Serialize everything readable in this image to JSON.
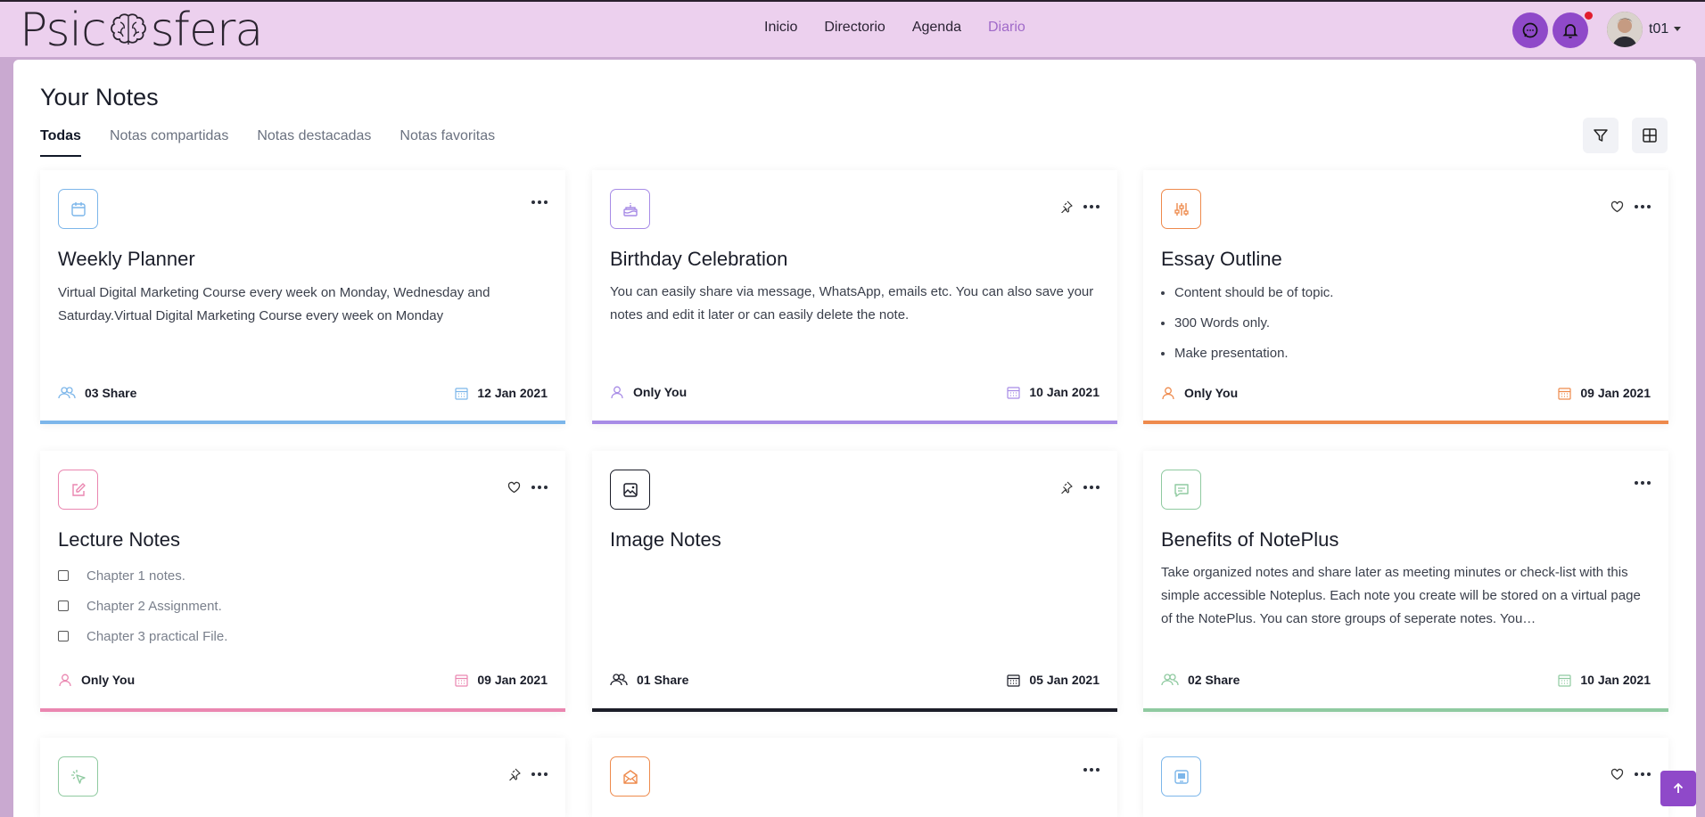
{
  "app": {
    "logo_left": "Psic",
    "logo_right": "sfera",
    "nav": [
      "Inicio",
      "Directorio",
      "Agenda",
      "Diario"
    ],
    "active_nav": "Diario",
    "user": "t01"
  },
  "page": {
    "title": "Your Notes",
    "tabs": [
      "Todas",
      "Notas compartidas",
      "Notas destacadas",
      "Notas favoritas"
    ],
    "active_tab": "Todas"
  },
  "cards": [
    {
      "title": "Weekly Planner",
      "desc": "Virtual Digital Marketing Course every week on Monday, Wednesday and Saturday.Virtual Digital Marketing Course every week on Monday",
      "share": "03 Share",
      "date": "12 Jan 2021",
      "color": "#7cb6ea",
      "icon": "calendar-icon"
    },
    {
      "title": "Birthday Celebration",
      "desc": "You can easily share via message, WhatsApp, emails etc. You can also save your notes and edit it later or can easily delete the note.",
      "share": "Only You",
      "date": "10 Jan 2021",
      "color": "#a78be6",
      "icon": "cake-icon"
    },
    {
      "title": "Essay Outline",
      "bullets": [
        "Content should be of topic.",
        "300 Words only.",
        "Make presentation."
      ],
      "share": "Only You",
      "date": "09 Jan 2021",
      "color": "#ee8a4c",
      "icon": "sliders-icon"
    },
    {
      "title": "Lecture Notes",
      "checks": [
        "Chapter 1 notes.",
        "Chapter 2 Assignment.",
        "Chapter 3 practical File."
      ],
      "share": "Only You",
      "date": "09 Jan 2021",
      "color": "#ea86b0",
      "icon": "edit-icon"
    },
    {
      "title": "Image Notes",
      "share": "01 Share",
      "date": "05 Jan 2021",
      "color": "#1b1d28",
      "icon": "image-icon"
    },
    {
      "title": "Benefits of NotePlus",
      "desc": "Take organized notes and share later as meeting minutes or check-list with this simple accessible Noteplus. Each note you create will be stored on a virtual page of the NotePlus. You can store groups of seperate notes. You…",
      "share": "02 Share",
      "date": "10 Jan 2021",
      "color": "#8fcaa0",
      "icon": "message-icon"
    },
    {
      "color": "#8fcaa0",
      "icon": "pointer-icon"
    },
    {
      "color": "#ee8a4c",
      "icon": "mail-open-icon"
    },
    {
      "color": "#7cb6ea",
      "icon": "tablet-icon"
    }
  ]
}
